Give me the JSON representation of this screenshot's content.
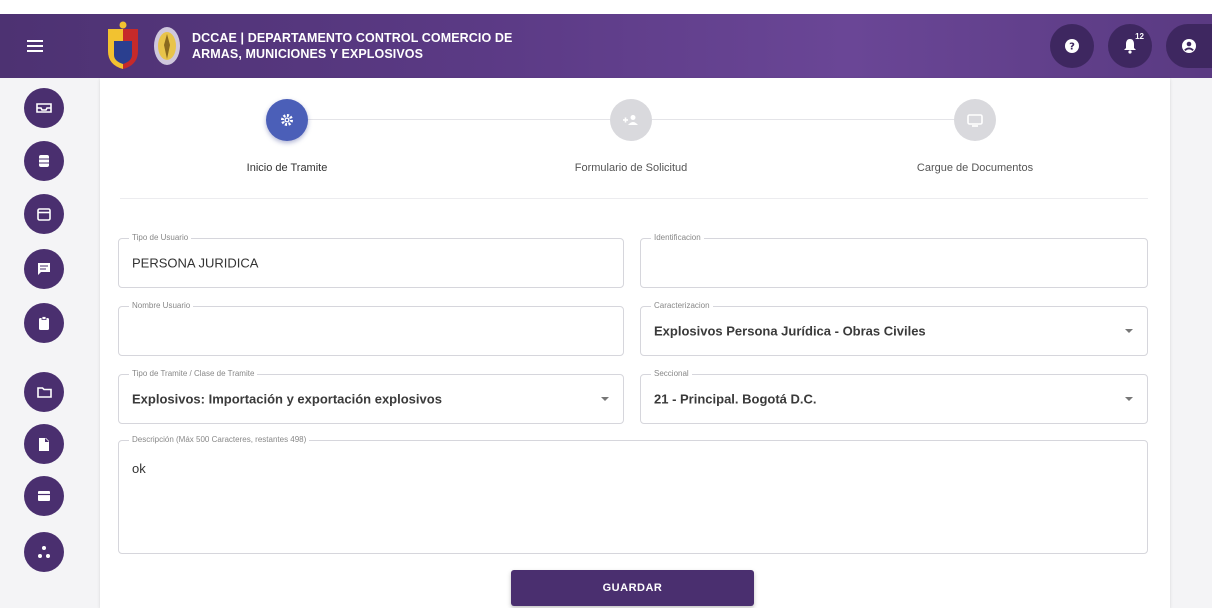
{
  "header": {
    "title_line1": "DCCAE | DEPARTAMENTO CONTROL COMERCIO DE",
    "title_line2": "ARMAS, MUNICIONES Y EXPLOSIVOS",
    "notification_count": "12",
    "bg_color": "#5b3a85"
  },
  "sidebar": {
    "items": [
      {
        "icon": "inbox-icon"
      },
      {
        "icon": "database-icon"
      },
      {
        "icon": "calendar-icon"
      },
      {
        "icon": "message-icon"
      },
      {
        "icon": "clipboard-icon"
      },
      {
        "icon": "folder-icon"
      },
      {
        "icon": "document-icon"
      },
      {
        "icon": "table-icon"
      },
      {
        "icon": "share-icon"
      }
    ]
  },
  "stepper": {
    "steps": [
      {
        "label": "Inicio de Tramite",
        "icon": "gear-icon",
        "state": "active"
      },
      {
        "label": "Formulario de Solicitud",
        "icon": "person-add-icon",
        "state": "inactive"
      },
      {
        "label": "Cargue de Documentos",
        "icon": "monitor-icon",
        "state": "inactive"
      }
    ]
  },
  "form": {
    "tipo_usuario": {
      "label": "Tipo de Usuario",
      "value": "PERSONA JURIDICA"
    },
    "identificacion": {
      "label": "Identificacion",
      "value": ""
    },
    "nombre_usuario": {
      "label": "Nombre Usuario",
      "value": ""
    },
    "caracterizacion": {
      "label": "Caracterizacion",
      "value": "Explosivos Persona Jurídica - Obras Civiles"
    },
    "tipo_tramite": {
      "label": "Tipo de Tramite / Clase de Tramite",
      "value": "Explosivos: Importación y exportación explosivos"
    },
    "seccional": {
      "label": "Seccional",
      "value": "21 - Principal. Bogotá D.C."
    },
    "descripcion": {
      "label": "Descripción (Máx 500 Caracteres, restantes 498)",
      "value": "ok"
    }
  },
  "actions": {
    "save_label": "GUARDAR"
  },
  "colors": {
    "primary": "#4a2f6f",
    "step_active": "#4b5fb8"
  }
}
